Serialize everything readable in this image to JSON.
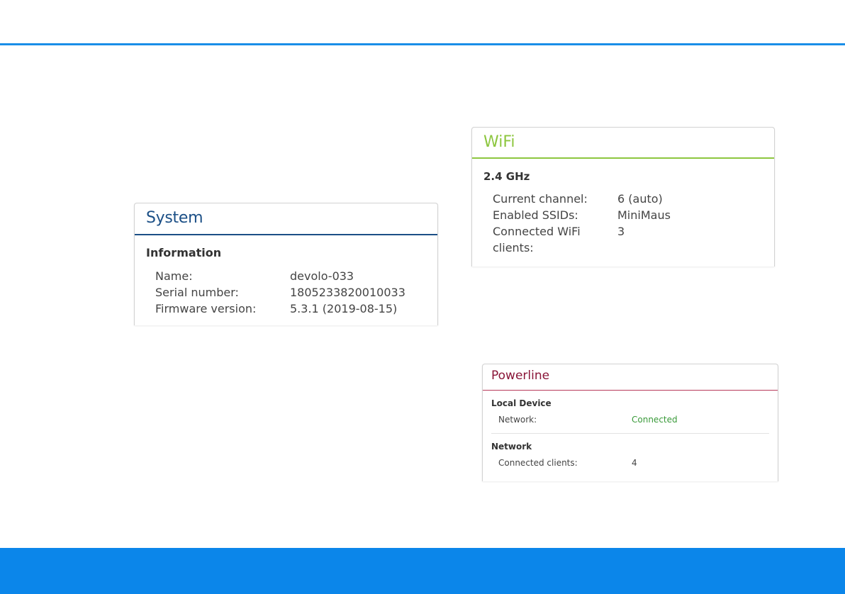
{
  "colors": {
    "accent_blue": "#1a8ee8",
    "footer_blue": "#0b86ea",
    "system_title": "#1b4f86",
    "wifi_title": "#8dc63f",
    "powerline_title": "#8a1538",
    "connected_green": "#3a9a3a"
  },
  "system": {
    "title": "System",
    "section": "Information",
    "rows": [
      {
        "label": "Name:",
        "value": "devolo-033"
      },
      {
        "label": "Serial number:",
        "value": "1805233820010033"
      },
      {
        "label": "Firmware version:",
        "value": "5.3.1 (2019-08-15)"
      }
    ]
  },
  "wifi": {
    "title": "WiFi",
    "section": "2.4 GHz",
    "rows": [
      {
        "label": "Current channel:",
        "value": "6 (auto)"
      },
      {
        "label": "Enabled SSIDs:",
        "value": "MiniMaus"
      },
      {
        "label": "Connected WiFi clients:",
        "value": "3"
      }
    ]
  },
  "powerline": {
    "title": "Powerline",
    "local_section": "Local Device",
    "local_rows": [
      {
        "label": "Network:",
        "value": "Connected"
      }
    ],
    "network_section": "Network",
    "network_rows": [
      {
        "label": "Connected clients:",
        "value": "4"
      }
    ]
  }
}
